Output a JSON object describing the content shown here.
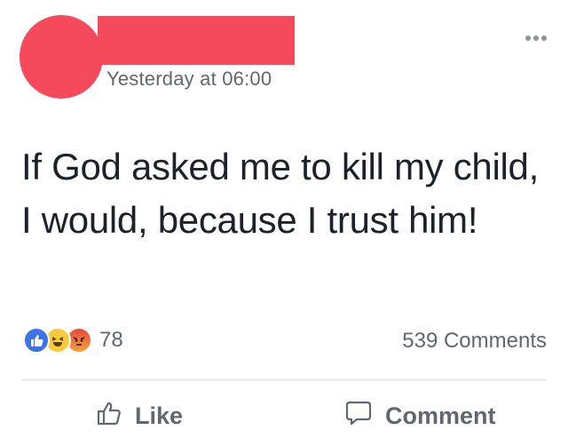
{
  "post": {
    "timestamp": "Yesterday at 06:00",
    "text": "If God asked me to kill my child, I would, because  I trust him!",
    "reaction_count": "78",
    "comments_count": "539 Comments",
    "reactions": [
      "like-icon",
      "haha-icon",
      "angry-icon"
    ]
  },
  "actions": {
    "like_label": "Like",
    "comment_label": "Comment"
  },
  "colors": {
    "redaction": "#f54a5b",
    "like_blue": "#3b73e8",
    "secondary_text": "#616770",
    "primary_text": "#1d2129"
  }
}
